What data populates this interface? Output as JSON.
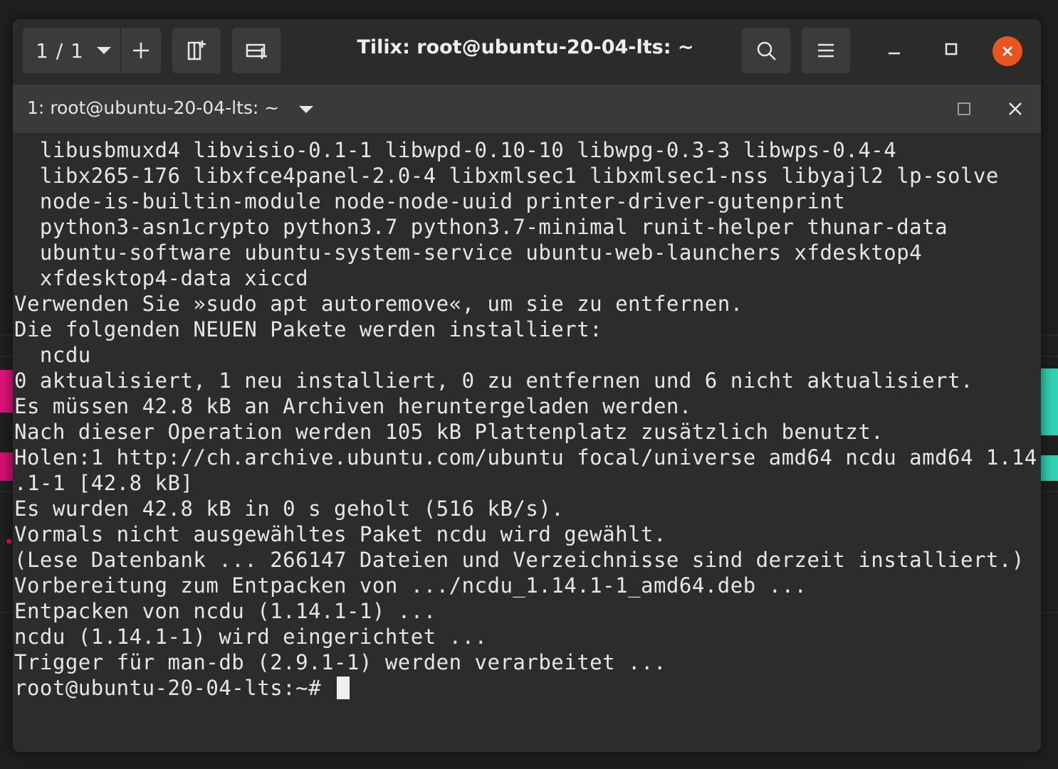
{
  "window": {
    "title": "Tilix: root@ubuntu-20-04-lts: ~",
    "session_label": "1 / 1"
  },
  "tab": {
    "title": "1: root@ubuntu-20-04-lts: ~"
  },
  "terminal": {
    "lines": [
      "  libusbmuxd4 libvisio-0.1-1 libwpd-0.10-10 libwpg-0.3-3 libwps-0.4-4",
      "  libx265-176 libxfce4panel-2.0-4 libxmlsec1 libxmlsec1-nss libyajl2 lp-solve",
      "  node-is-builtin-module node-node-uuid printer-driver-gutenprint",
      "  python3-asn1crypto python3.7 python3.7-minimal runit-helper thunar-data",
      "  ubuntu-software ubuntu-system-service ubuntu-web-launchers xfdesktop4",
      "  xfdesktop4-data xiccd",
      "Verwenden Sie »sudo apt autoremove«, um sie zu entfernen.",
      "Die folgenden NEUEN Pakete werden installiert:",
      "  ncdu",
      "0 aktualisiert, 1 neu installiert, 0 zu entfernen und 6 nicht aktualisiert.",
      "Es müssen 42.8 kB an Archiven heruntergeladen werden.",
      "Nach dieser Operation werden 105 kB Plattenplatz zusätzlich benutzt.",
      "Holen:1 http://ch.archive.ubuntu.com/ubuntu focal/universe amd64 ncdu amd64 1.14",
      ".1-1 [42.8 kB]",
      "Es wurden 42.8 kB in 0 s geholt (516 kB/s).",
      "Vormals nicht ausgewähltes Paket ncdu wird gewählt.",
      "(Lese Datenbank ... 266147 Dateien und Verzeichnisse sind derzeit installiert.)",
      "Vorbereitung zum Entpacken von .../ncdu_1.14.1-1_amd64.deb ...",
      "Entpacken von ncdu (1.14.1-1) ...",
      "ncdu (1.14.1-1) wird eingerichtet ...",
      "Trigger für man-db (2.9.1-1) werden verarbeitet ..."
    ],
    "prompt": "root@ubuntu-20-04-lts:~# "
  },
  "icons": {
    "session_caret": "chevron-down-icon",
    "add": "plus-icon",
    "split_vertical": "split-vertical-icon",
    "split_horizontal": "split-horizontal-icon",
    "search": "search-icon",
    "menu": "hamburger-menu-icon",
    "minimize": "minimize-icon",
    "maximize": "maximize-icon",
    "close": "close-icon"
  },
  "colors": {
    "close_button": "#e95420",
    "terminal_bg": "#2c2c2c",
    "terminal_fg": "#e6e6e6"
  }
}
